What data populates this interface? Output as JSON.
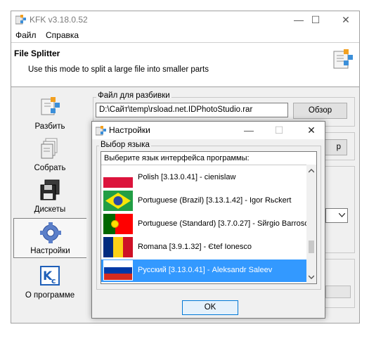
{
  "app": {
    "title": "KFK v3.18.0.52",
    "window_controls": {
      "minimize": "—",
      "maximize": "☐",
      "close": "✕"
    }
  },
  "menu": {
    "items": [
      "Файл",
      "Справка"
    ]
  },
  "header": {
    "title": "File Splitter",
    "subtitle": "Use this mode to split a large file into smaller parts",
    "icon": "puzzle-file-icon"
  },
  "sidebar": {
    "items": [
      {
        "label": "Разбить",
        "icon": "puzzle-file-icon"
      },
      {
        "label": "Собрать",
        "icon": "stacked-pages-icon"
      },
      {
        "label": "Дискеты",
        "icon": "floppy-disks-icon"
      },
      {
        "label": "Настройки",
        "icon": "gear-icon",
        "selected": true
      },
      {
        "label": "О программе",
        "icon": "kc-logo-icon"
      }
    ]
  },
  "main": {
    "file_group_label": "Файл для разбивки",
    "file_path": "D:\\Сайт\\temp\\rsload.net.IDPhotoStudio.rar",
    "browse_button": "Обзор",
    "second_button_fragment": "р"
  },
  "dialog": {
    "title": "Настройки",
    "controls": {
      "minimize": "—",
      "maximize": "☐",
      "close": "✕"
    },
    "group_label": "Выбор языка",
    "list_header": "Выберите язык интерфейса программы:",
    "languages": [
      {
        "label": "Polish [3.13.0.41] - cienislaw",
        "flag": "pl"
      },
      {
        "label": "Portuguese (Brazil) [3.13.1.42] - Igor Rьckert",
        "flag": "br"
      },
      {
        "label": "Portuguese (Standard) [3.7.0.27] - Sйrgio Barroso",
        "flag": "pt"
      },
      {
        "label": "Romana [3.9.1.32] - Єtef Ionesco",
        "flag": "ro"
      },
      {
        "label": "Русский [3.13.0.41] - Aleksandr Saleev",
        "flag": "ru",
        "selected": true
      }
    ],
    "ok_button": "OK",
    "colors": {
      "selection": "#3399ff"
    }
  }
}
